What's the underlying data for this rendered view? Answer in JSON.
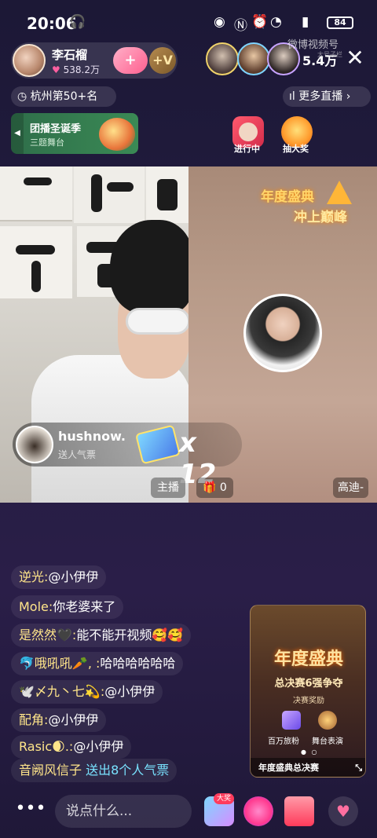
{
  "status_bar": {
    "time": "20:06",
    "battery": "84",
    "icons": [
      "headphones-icon",
      "eye-icon",
      "nfc-icon",
      "location-icon",
      "wifi-icon",
      "signal-5g-icon",
      "battery-icon"
    ]
  },
  "host": {
    "name": "李石榴",
    "likes": "538.2万",
    "follow_symbol": "+",
    "fan_symbol": "+V"
  },
  "audience": {
    "count": "5.4万",
    "watermark": "微博视频号",
    "watermark_sub": "大号子栏"
  },
  "rank": {
    "label": "杭州第50+名"
  },
  "more_live": {
    "label": "更多直播"
  },
  "promo": {
    "title": "团播圣诞季",
    "subtitle": "三题舞台"
  },
  "actions": [
    {
      "label": "进行中"
    },
    {
      "label": "抽大奖"
    }
  ],
  "overlay": {
    "year_line1": "年度盛典",
    "year_line2": "冲上巅峰"
  },
  "gift": {
    "user": "hushnow.",
    "desc": "送人气票",
    "count": "x 12"
  },
  "video_labels": {
    "host": "主播",
    "score": "0",
    "quality": "高迪-"
  },
  "comments": [
    {
      "name": "逆光:",
      "text": "@小伊伊"
    },
    {
      "name": "Mole:",
      "text": "你老婆来了"
    },
    {
      "name": "是然然🖤:",
      "text": "能不能开视频🥰🥰"
    },
    {
      "name": "🐬哦吼吼🥕, :",
      "text": "哈哈哈哈哈哈"
    },
    {
      "name": "🕊️〆九丶七💫:",
      "text": "@小伊伊"
    },
    {
      "name": "配角:",
      "text": "@小伊伊"
    },
    {
      "name": "Rasic🌒.:",
      "text": "@小伊伊"
    },
    {
      "name": "音阙风信子",
      "text": "送出8个人气票"
    }
  ],
  "event_card": {
    "title": "年度盛典",
    "subtitle": "总决赛6强争夺",
    "reward_label": "决赛奖励",
    "reward1": "百万旅粉",
    "reward2": "舞台表演",
    "bottom": "年度盛典总决赛"
  },
  "bottom_bar": {
    "more": "•••",
    "placeholder": "说点什么...",
    "badge": "大奖"
  }
}
